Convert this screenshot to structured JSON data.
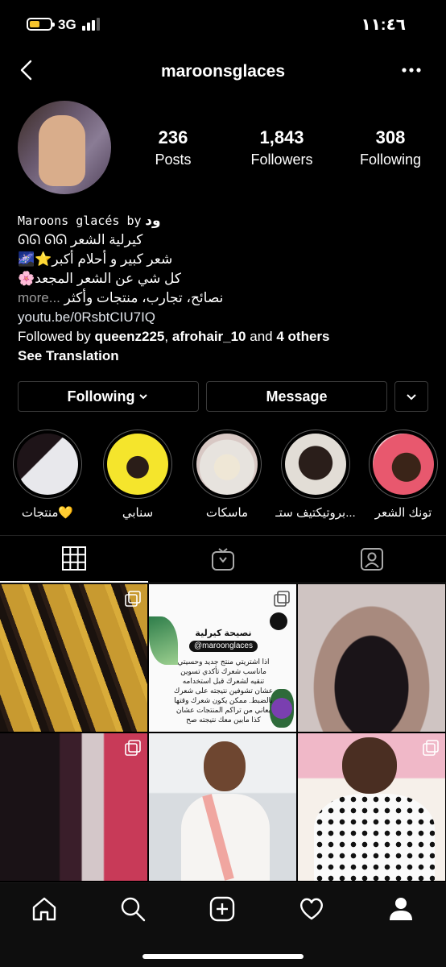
{
  "status_bar": {
    "network": "3G",
    "time": "١١:٤٦",
    "battery_color": "#f6c42d"
  },
  "nav": {
    "username": "maroonsglaces",
    "back_icon": "chevron-left-icon",
    "more_icon": "ellipsis-icon"
  },
  "stats": [
    {
      "number": "236",
      "label": "Posts"
    },
    {
      "number": "1,843",
      "label": "Followers"
    },
    {
      "number": "308",
      "label": "Following"
    }
  ],
  "bio": {
    "name_latin": "Maroons glacés by",
    "name_arabic": "ود",
    "line1": "ᘏᘏ ᘏᘏ كيرلية الشعر",
    "line2": "شعر كبير و أحلام أكبر⭐🌌",
    "line3": "كل شي عن الشعر المجعد🌸",
    "line4": "نصائح، تجارب، منتجات وأكثر",
    "more": "more",
    "ellipsis": "...",
    "link": "youtu.be/0RsbtCIU7IQ",
    "followed_by_prefix": "Followed by",
    "followed_user1": "queenz225",
    "followed_sep": ",",
    "followed_user2": "afrohair_10",
    "followed_and": "and",
    "followed_others": "4 others",
    "see_translation": "See Translation"
  },
  "buttons": {
    "following": "Following",
    "message": "Message"
  },
  "highlights": [
    {
      "label": "منتجات💛"
    },
    {
      "label": "سنابي"
    },
    {
      "label": "ماسكات"
    },
    {
      "label": "بروتيكتيف ستـ..."
    },
    {
      "label": "تونك الشعر"
    }
  ],
  "tabs": [
    {
      "icon": "grid-icon",
      "active": true
    },
    {
      "icon": "igtv-icon",
      "active": false
    },
    {
      "icon": "tagged-icon",
      "active": false
    }
  ],
  "card_post": {
    "title": "نصيحة كيرلية",
    "handle": "@maroonglaces",
    "body": "اذا اشتريتي منتج جديد وحسيتي ماناسب شعرك تأكدي تسوين تنقيه لشعرك قبل استخدامه عشان تشوفين نتيجته على شعرك بالضبط. ممكن يكون شعرك وقتها يعاني من تراكم المنتجات عشان كذا مابين معك نتيجته صح"
  },
  "bottom_nav": [
    {
      "icon": "home-icon"
    },
    {
      "icon": "search-icon"
    },
    {
      "icon": "new-post-icon"
    },
    {
      "icon": "heart-icon"
    },
    {
      "icon": "profile-icon"
    }
  ]
}
